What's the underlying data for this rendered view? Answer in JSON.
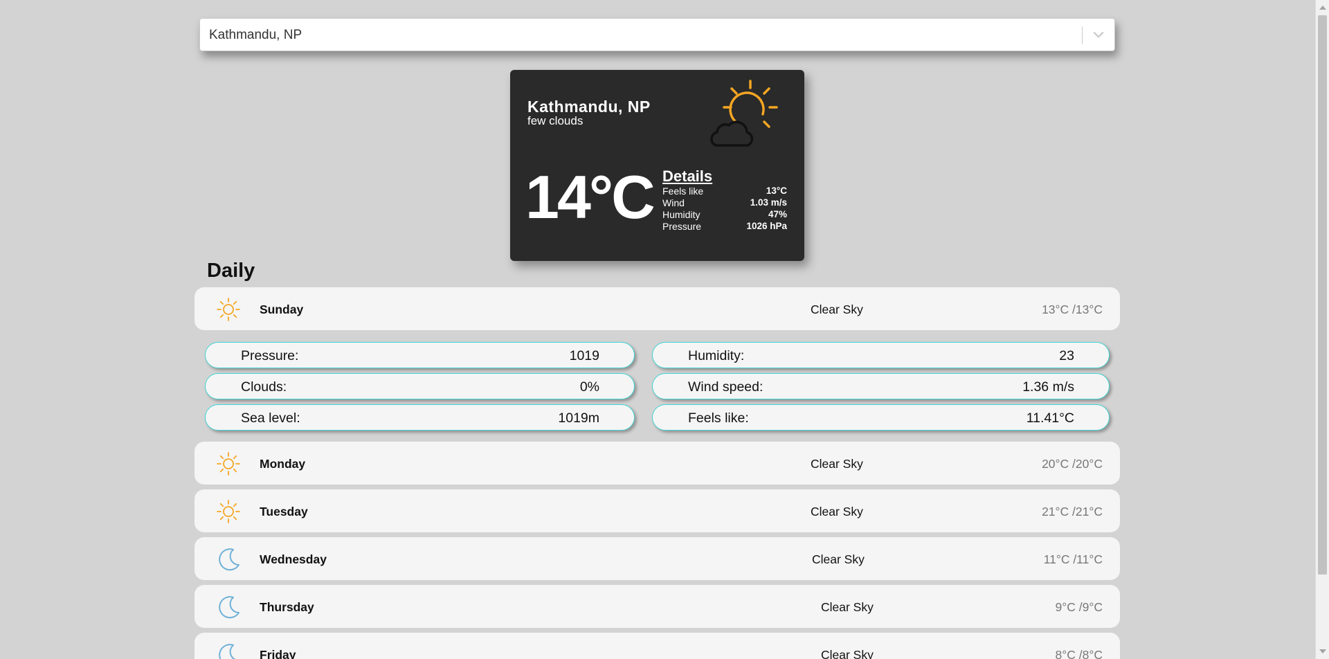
{
  "search": {
    "value": "Kathmandu, NP"
  },
  "current": {
    "city": "Kathmandu, NP",
    "description": "few clouds",
    "temperature": "14°C",
    "icon": "sun-behind-cloud-icon",
    "details_title": "Details",
    "details": [
      {
        "label": "Feels like",
        "value": "13°C"
      },
      {
        "label": "Wind",
        "value": "1.03 m/s"
      },
      {
        "label": "Humidity",
        "value": "47%"
      },
      {
        "label": "Pressure",
        "value": "1026 hPa"
      }
    ]
  },
  "daily": {
    "title": "Daily",
    "days": [
      {
        "name": "Sunday",
        "condition": "Clear Sky",
        "temp": "13°C /13°C",
        "icon": "sun-icon"
      },
      {
        "name": "Monday",
        "condition": "Clear Sky",
        "temp": "20°C /20°C",
        "icon": "sun-icon"
      },
      {
        "name": "Tuesday",
        "condition": "Clear Sky",
        "temp": "21°C /21°C",
        "icon": "sun-icon"
      },
      {
        "name": "Wednesday",
        "condition": "Clear Sky",
        "temp": "11°C /11°C",
        "icon": "moon-icon"
      },
      {
        "name": "Thursday",
        "condition": "Clear Sky",
        "temp": "9°C /9°C",
        "icon": "moon-icon"
      },
      {
        "name": "Friday",
        "condition": "Clear Sky",
        "temp": "8°C /8°C",
        "icon": "moon-icon"
      }
    ],
    "expanded_details": [
      {
        "label": "Pressure:",
        "value": "1019"
      },
      {
        "label": "Humidity:",
        "value": "23"
      },
      {
        "label": "Clouds:",
        "value": "0%"
      },
      {
        "label": "Wind speed:",
        "value": "1.36 m/s"
      },
      {
        "label": "Sea level:",
        "value": "1019m"
      },
      {
        "label": "Feels like:",
        "value": "11.41°C"
      }
    ]
  },
  "colors": {
    "background": "#d3d3d3",
    "card": "#2a2a2a",
    "sun": "#f5a623",
    "moon": "#6fb0d6",
    "pill_border": "#43d4d4"
  }
}
